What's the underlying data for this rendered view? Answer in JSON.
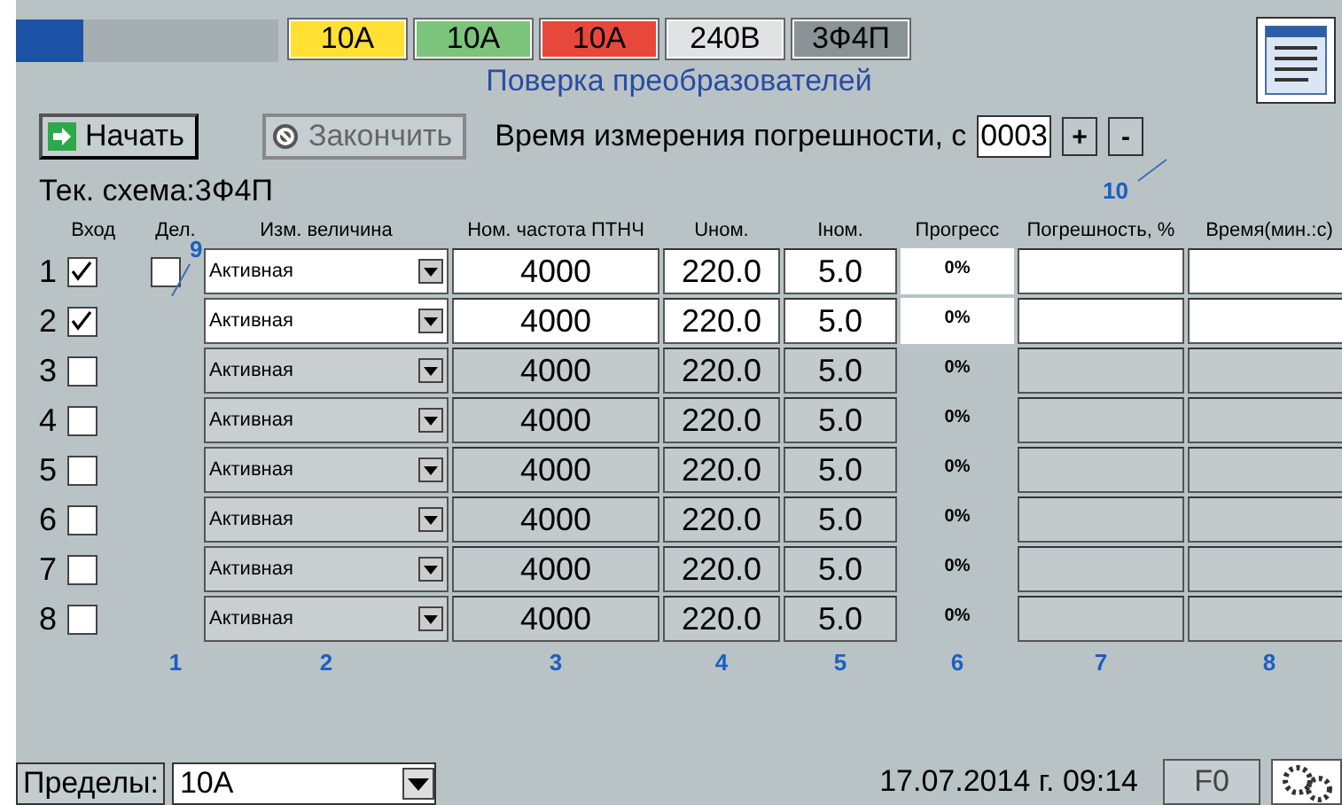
{
  "badges": [
    {
      "label": "10A",
      "color": "#ffe033"
    },
    {
      "label": "10A",
      "color": "#7cc47c"
    },
    {
      "label": "10A",
      "color": "#e8473b"
    },
    {
      "label": "240В",
      "color": "#dfe3e4"
    },
    {
      "label": "3Ф4П",
      "color": "#8a9496"
    }
  ],
  "title": "Поверка преобразователей",
  "start_button": "Начать",
  "stop_button": {
    "label": "Закончить",
    "disabled": true
  },
  "measure_time": {
    "label": "Время измерения погрешности, с",
    "value": "0003",
    "plus": "+",
    "minus": "-"
  },
  "scheme": "Тек. схема:3Ф4П",
  "columns": [
    "Вход",
    "Дел.",
    "Изм. величина",
    "Ном. частота ПТНЧ",
    "Uном.",
    "Iном.",
    "Прогресс",
    "Погрешность, %",
    "Время(мин.:с)"
  ],
  "rows": [
    {
      "num": "1",
      "checked": true,
      "split": false,
      "quantity": "Активная",
      "freq": "4000",
      "u": "220.0",
      "i": "5.0",
      "progress": "0%"
    },
    {
      "num": "2",
      "checked": true,
      "quantity": "Активная",
      "freq": "4000",
      "u": "220.0",
      "i": "5.0",
      "progress": "0%"
    },
    {
      "num": "3",
      "checked": false,
      "quantity": "Активная",
      "freq": "4000",
      "u": "220.0",
      "i": "5.0",
      "progress": "0%"
    },
    {
      "num": "4",
      "checked": false,
      "quantity": "Активная",
      "freq": "4000",
      "u": "220.0",
      "i": "5.0",
      "progress": "0%"
    },
    {
      "num": "5",
      "checked": false,
      "quantity": "Активная",
      "freq": "4000",
      "u": "220.0",
      "i": "5.0",
      "progress": "0%"
    },
    {
      "num": "6",
      "checked": false,
      "quantity": "Активная",
      "freq": "4000",
      "u": "220.0",
      "i": "5.0",
      "progress": "0%"
    },
    {
      "num": "7",
      "checked": false,
      "quantity": "Активная",
      "freq": "4000",
      "u": "220.0",
      "i": "5.0",
      "progress": "0%"
    },
    {
      "num": "8",
      "checked": false,
      "quantity": "Активная",
      "freq": "4000",
      "u": "220.0",
      "i": "5.0",
      "progress": "0%"
    }
  ],
  "column_callouts": [
    "1",
    "2",
    "3",
    "4",
    "5",
    "6",
    "7",
    "8"
  ],
  "callout_split": "9",
  "callout_time": "10",
  "limits": {
    "label": "Пределы:",
    "value": "10A"
  },
  "datetime": "17.07.2014 г.  09:14",
  "f_button": "F0"
}
